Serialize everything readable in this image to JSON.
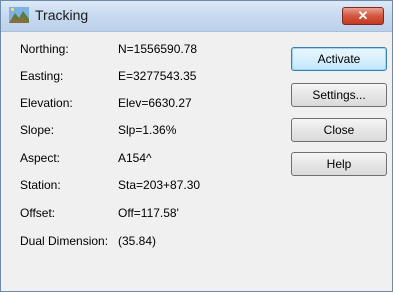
{
  "window": {
    "title": "Tracking",
    "close_glyph": "✕"
  },
  "fields": [
    {
      "label": "Northing:",
      "value": "N=1556590.78"
    },
    {
      "label": "Easting:",
      "value": "E=3277543.35"
    },
    {
      "label": "Elevation:",
      "value": "Elev=6630.27"
    },
    {
      "label": "Slope:",
      "value": "Slp=1.36%"
    },
    {
      "label": "Aspect:",
      "value": "A154^"
    },
    {
      "label": "Station:",
      "value": "Sta=203+87.30"
    },
    {
      "label": "Offset:",
      "value": "Off=117.58'"
    },
    {
      "label": "Dual Dimension:",
      "value": "(35.84)"
    }
  ],
  "buttons": {
    "activate": "Activate",
    "settings": "Settings...",
    "close": "Close",
    "help": "Help"
  },
  "colors": {
    "titlebar": "#c5d8ee",
    "close_button": "#c23b22",
    "default_button_border": "#3c7fb1"
  }
}
